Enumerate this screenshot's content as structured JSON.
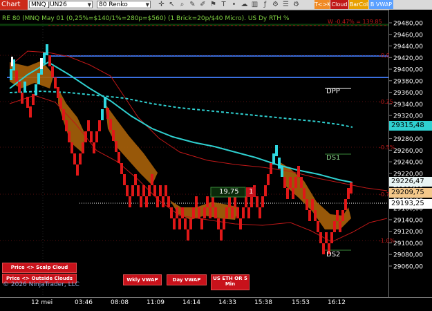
{
  "toolbar": {
    "chart_label": "Chart",
    "instrument": "MNQ JUN26",
    "bar_type": "80 Renko",
    "buttons": [
      "T<>K",
      "Cloud",
      "BarCol",
      "B VWAP"
    ],
    "button_colors": [
      "#f08a24",
      "#c01818",
      "#e8a000",
      "#5aa0ff"
    ],
    "icons": [
      "crosshair-icon",
      "cursor-icon",
      "zoom-icon",
      "draw-icon",
      "pencil-icon",
      "flag-icon",
      "text-icon",
      "dot-icon",
      "cloud-icon",
      "bars-icon",
      "indicator-icon",
      "strategy-icon",
      "properties-icon",
      "settings-icon"
    ]
  },
  "chart_header": "RE 80 (MNQ May 01 (0,25%=$140/1%=280p=$560) (1 Brick=20p/$40 Micro). US Dy RTH %",
  "right_header": "W -0.47% = 139.85",
  "y_axis_ticks": [
    "29480,00",
    "29460,00",
    "29440,00",
    "29420,00",
    "29400,00",
    "29380,00",
    "29360,00",
    "29340,00",
    "29320,00",
    "29300,00",
    "29280,00",
    "29260,00",
    "29240,00",
    "29220,00",
    "29200,00",
    "29180,00",
    "29160,00",
    "29140,00",
    "29120,00",
    "29100,00",
    "29080,00",
    "29060,00"
  ],
  "x_axis_labels": [
    "12 mei",
    "03:46",
    "08:08",
    "11:09",
    "14:14",
    "14:33",
    "15:38",
    "15:53",
    "16:12"
  ],
  "price_tags": [
    {
      "text": "29315,48",
      "bg": "#2fd0d0",
      "fg": "#000000"
    },
    {
      "text": "29226,47",
      "bg": "#e8f4f4",
      "fg": "#000000"
    },
    {
      "text": "29209,75",
      "bg": "#f4c88a",
      "fg": "#000000"
    },
    {
      "text": "29193,25",
      "bg": "#ffffff",
      "fg": "#000000"
    }
  ],
  "level_labels": {
    "dpp": "DPP",
    "ds1": "DS1",
    "ds2": "DS2",
    "pct_0": "-0,0",
    "pct_25": "-0.25",
    "pct_5": "-0.5%",
    "pct_75": "-0.7%",
    "pct_1": "-1.0%"
  },
  "position_box": {
    "price": "19,75",
    "qty": "1"
  },
  "bottom_buttons": {
    "scalp_cloud": "Price <> Scalp Cloud",
    "outside_clouds": "Price <> Outside Clouds",
    "wkly_vwap": "Wkly VWAP",
    "day_vwap": "Day VWAP",
    "us_eth": "US ETH OR 5",
    "us_eth_2": "Min"
  },
  "copyright": "© 2026 NinjaTrader, LLC",
  "colors": {
    "bull": "#2fd8e0",
    "bear": "#e01818",
    "cloud": "#b8680a",
    "vwap": "#2fd0d0",
    "blue_line": "#3a6fe0",
    "band_red": "#c01818"
  }
}
